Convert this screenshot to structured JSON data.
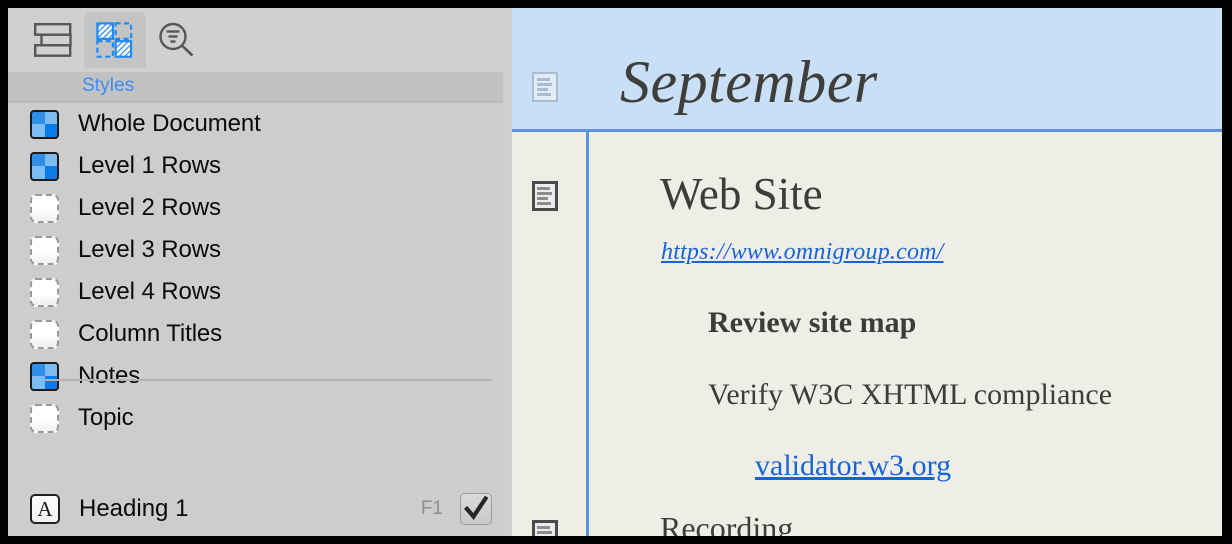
{
  "inspector": {
    "toolbar": {
      "buttons": [
        {
          "name": "outline-rows-icon",
          "label": "Outline",
          "active": false
        },
        {
          "name": "styles-icon",
          "label": "Styles",
          "active": true
        },
        {
          "name": "filter-search-icon",
          "label": "Search",
          "active": false
        }
      ]
    },
    "header": {
      "title": "Styles",
      "title_color": "#3c8cf5"
    },
    "styles": [
      {
        "label": "Whole Document",
        "state": "on"
      },
      {
        "label": "Level 1 Rows",
        "state": "on"
      },
      {
        "label": "Level 2 Rows",
        "state": "off"
      },
      {
        "label": "Level 3 Rows",
        "state": "off"
      },
      {
        "label": "Level 4 Rows",
        "state": "off"
      },
      {
        "label": "Column Titles",
        "state": "off"
      },
      {
        "label": "Notes",
        "state": "on"
      },
      {
        "label": "Topic",
        "state": "off"
      }
    ],
    "named_style": {
      "badge_letter": "A",
      "label": "Heading 1",
      "shortcut": "F1",
      "checked": true
    }
  },
  "document": {
    "selection_color": "#c9dff5",
    "background_color": "#eeeee6",
    "rows": [
      {
        "text": "September",
        "style": "title-italic",
        "gutter_icon": "note-icon",
        "selected": true
      },
      {
        "text": "Web Site",
        "style": "heading",
        "gutter_icon": "note-icon",
        "selected": false
      },
      {
        "text": "https://www.omnigroup.com/",
        "style": "link-italic",
        "link_color": "#1565d8"
      },
      {
        "text": "Review site map",
        "style": "subheading-bold"
      },
      {
        "text": "Verify W3C XHTML compliance",
        "style": "body"
      },
      {
        "text": "validator.w3.org",
        "style": "link",
        "link_color": "#1565d8"
      },
      {
        "text": "Recording",
        "style": "body",
        "gutter_icon": "note-icon",
        "clipped": true
      }
    ]
  }
}
